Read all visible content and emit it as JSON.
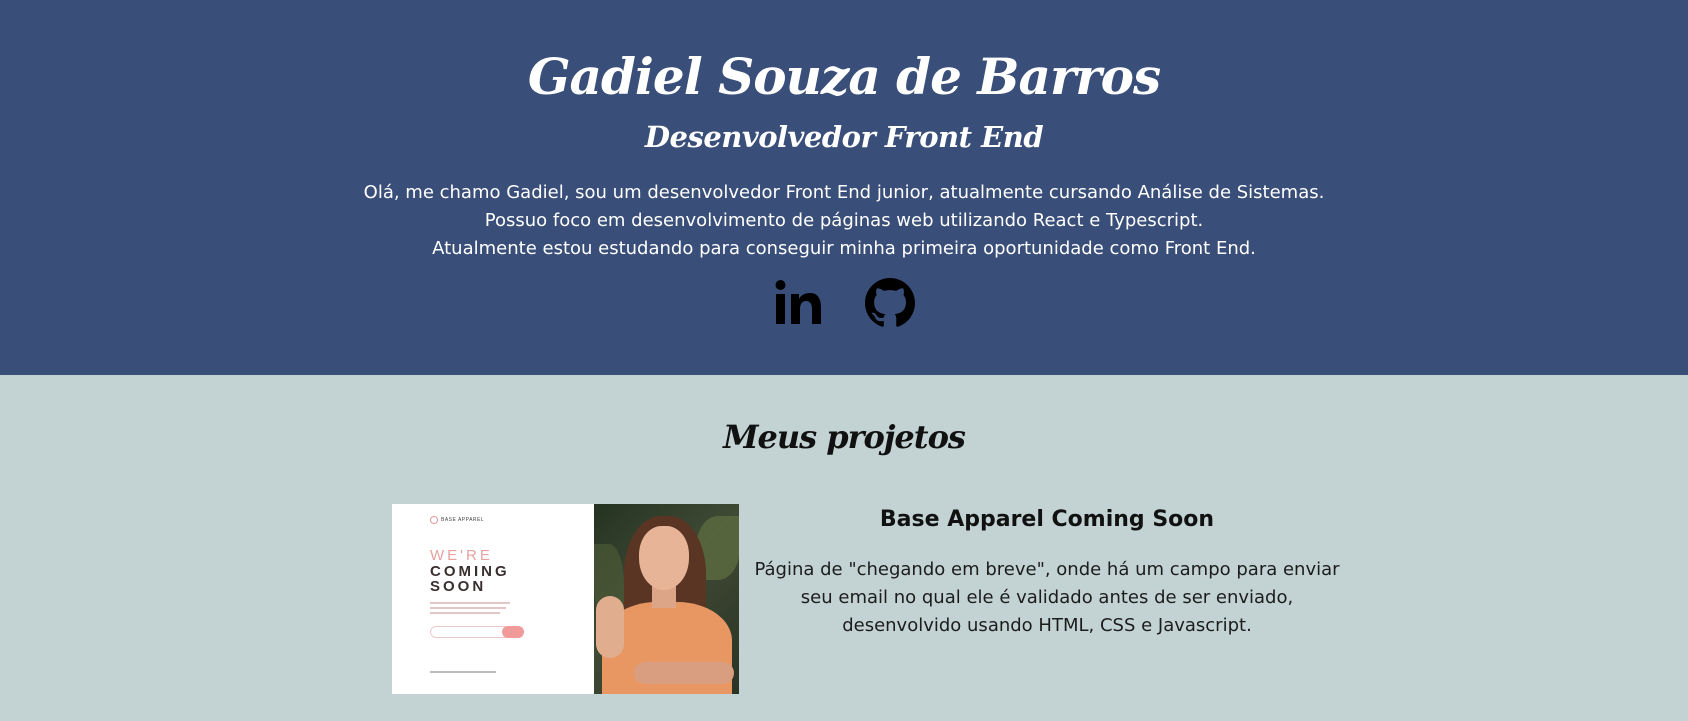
{
  "hero": {
    "name": "Gadiel Souza de Barros",
    "role": "Desenvolvedor Front End",
    "bio": [
      "Olá, me chamo Gadiel, sou um desenvolvedor Front End junior, atualmente cursando Análise de Sistemas.",
      "Possuo foco em desenvolvimento de páginas web utilizando React e Typescript.",
      "Atualmente estou estudando para conseguir minha primeira oportunidade como Front End."
    ],
    "socials": [
      {
        "icon": "linkedin-icon"
      },
      {
        "icon": "github-icon"
      }
    ]
  },
  "projects": {
    "title": "Meus projetos",
    "items": [
      {
        "title": "Base Apparel Coming Soon",
        "description": [
          "Página de \"chegando em breve\", onde há um campo para enviar",
          "seu email no qual ele é validado antes de ser enviado,",
          "desenvolvido usando HTML, CSS e Javascript."
        ],
        "thumbnail": {
          "logo": "BASE APPAREL",
          "headline_1": "WE'RE",
          "headline_2": "COMING",
          "headline_3": "SOON"
        }
      }
    ]
  },
  "colors": {
    "hero_bg": "#394e78",
    "projects_bg": "#c3d3d3",
    "text_light": "#ffffff",
    "text_dark": "#111111",
    "accent": "#f19a9a"
  }
}
